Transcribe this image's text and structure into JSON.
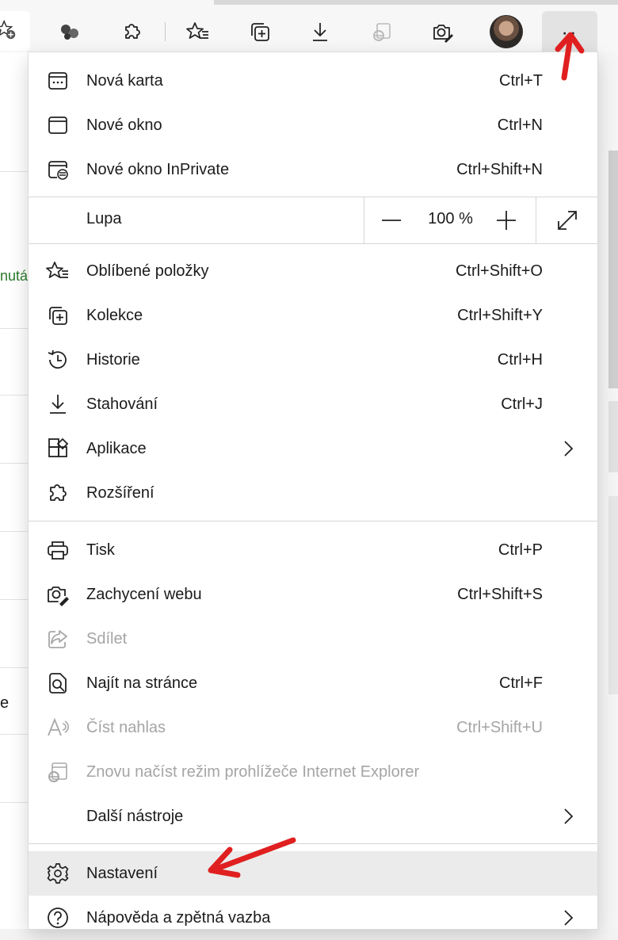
{
  "toolbar": {
    "icons": [
      "add-favorite-icon",
      "molecule-icon",
      "extensions-icon",
      "favorites-icon",
      "collections-icon",
      "downloads-icon",
      "ie-mode-icon",
      "web-capture-icon",
      "profile-avatar",
      "more-icon"
    ],
    "more_label": "··"
  },
  "page": {
    "partial_text_1": "nutá",
    "partial_text_2": "e"
  },
  "menu": {
    "new_tab": {
      "label": "Nová karta",
      "shortcut": "Ctrl+T"
    },
    "new_window": {
      "label": "Nové okno",
      "shortcut": "Ctrl+N"
    },
    "inprivate": {
      "label": "Nové okno InPrivate",
      "shortcut": "Ctrl+Shift+N"
    },
    "zoom": {
      "label": "Lupa",
      "value": "100 %"
    },
    "favorites": {
      "label": "Oblíbené položky",
      "shortcut": "Ctrl+Shift+O"
    },
    "collections": {
      "label": "Kolekce",
      "shortcut": "Ctrl+Shift+Y"
    },
    "history": {
      "label": "Historie",
      "shortcut": "Ctrl+H"
    },
    "downloads": {
      "label": "Stahování",
      "shortcut": "Ctrl+J"
    },
    "apps": {
      "label": "Aplikace"
    },
    "extensions": {
      "label": "Rozšíření"
    },
    "print": {
      "label": "Tisk",
      "shortcut": "Ctrl+P"
    },
    "web_capture": {
      "label": "Zachycení webu",
      "shortcut": "Ctrl+Shift+S"
    },
    "share": {
      "label": "Sdílet"
    },
    "find": {
      "label": "Najít na stránce",
      "shortcut": "Ctrl+F"
    },
    "read_aloud": {
      "label": "Číst nahlas",
      "shortcut": "Ctrl+Shift+U"
    },
    "ie_reload": {
      "label": "Znovu načíst režim prohlížeče Internet Explorer"
    },
    "more_tools": {
      "label": "Další nástroje"
    },
    "settings": {
      "label": "Nastavení"
    },
    "help": {
      "label": "Nápověda a zpětná vazba"
    }
  },
  "colors": {
    "annotation_arrow": "#e02020",
    "hover_bg": "#ebebeb",
    "disabled_text": "#a5a5a5"
  }
}
